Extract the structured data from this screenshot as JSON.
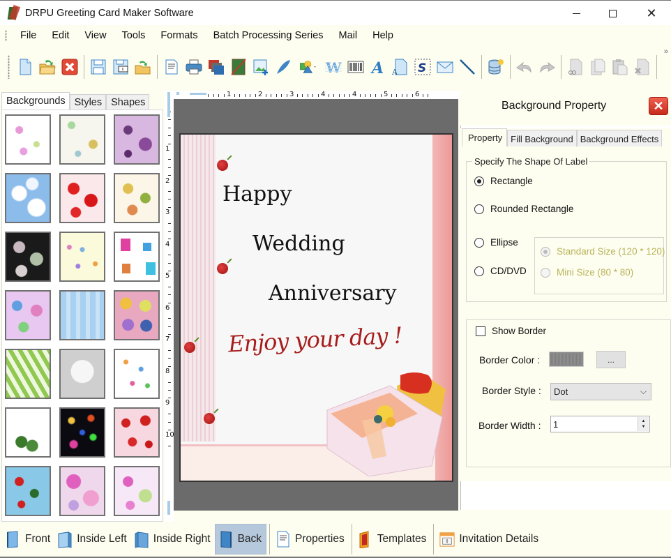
{
  "window": {
    "title": "DRPU Greeting Card Maker Software",
    "controls": [
      "minimize",
      "maximize",
      "close"
    ]
  },
  "menu": [
    "File",
    "Edit",
    "View",
    "Tools",
    "Formats",
    "Batch Processing Series",
    "Mail",
    "Help"
  ],
  "toolbar": {
    "groups": [
      [
        "new-icon",
        "open-icon",
        "close-file-icon"
      ],
      [
        "save-icon",
        "save-as-icon",
        "export-icon"
      ],
      [
        "print-preview-icon",
        "print-icon",
        "batch-print-icon",
        "crop-image-icon",
        "insert-picture-icon",
        "signature-pen-icon",
        "shapes-icon",
        "wordart-icon",
        "barcode-icon",
        "text-icon",
        "text-document-icon",
        "signature-icon",
        "email-icon",
        "line-icon"
      ],
      [
        "database-icon"
      ],
      [
        "undo-icon",
        "redo-icon"
      ],
      [
        "cut-icon",
        "copy-icon",
        "paste-icon",
        "delete-icon"
      ]
    ],
    "overflow_label": "»"
  },
  "left_panel": {
    "tabs": [
      {
        "label": "Backgrounds",
        "active": true
      },
      {
        "label": "Styles",
        "active": false
      },
      {
        "label": "Shapes",
        "active": false
      }
    ],
    "thumbnails": [
      "baby-doodles",
      "baby-sketch",
      "purple-flowers",
      "sky-clouds",
      "strawberries",
      "autumn-leaves",
      "dark-leaves",
      "hearts-rows",
      "gift-boxes",
      "colorful-flowers",
      "blue-snowflakes",
      "pink-circles",
      "green-trees",
      "white-heart",
      "kids-doodles",
      "green-ornament",
      "fireworks",
      "red-hearts",
      "santa-pattern",
      "pink-pompoms",
      "pink-butterflies"
    ]
  },
  "rulers": {
    "top_labels": [
      "1",
      "2",
      "3",
      "4",
      "4",
      "5",
      "6"
    ],
    "left_labels": [
      "1",
      "2",
      "3",
      "4",
      "5",
      "6",
      "7",
      "8",
      "9",
      "10"
    ]
  },
  "card": {
    "line1": "Happy",
    "line2": "Wedding",
    "line3": "Anniversary",
    "script": "Enjoy your day !"
  },
  "property_panel": {
    "title": "Background Property",
    "tabs": [
      {
        "label": "Property",
        "active": true
      },
      {
        "label": "Fill Background",
        "active": false
      },
      {
        "label": "Background Effects",
        "active": false
      }
    ],
    "shape_group": {
      "legend": "Specify The Shape Of Label",
      "options": [
        {
          "label": "Rectangle",
          "checked": true
        },
        {
          "label": "Rounded Rectangle",
          "checked": false
        },
        {
          "label": "Ellipse",
          "checked": false
        },
        {
          "label": "CD/DVD",
          "checked": false
        }
      ],
      "cd_sizes": [
        {
          "label": "Standard Size (120 * 120)",
          "checked": true,
          "enabled": false
        },
        {
          "label": "Mini Size (80 * 80)",
          "checked": false,
          "enabled": false
        }
      ]
    },
    "border": {
      "show_border_label": "Show Border",
      "show_border": false,
      "color_label": "Border Color :",
      "color_value": "#8a8a8a",
      "color_button": "...",
      "style_label": "Border Style :",
      "style_value": "Dot",
      "width_label": "Border Width :",
      "width_value": "1"
    }
  },
  "bottom_bar": [
    {
      "label": "Front",
      "icon": "front-page-icon",
      "active": false
    },
    {
      "label": "Inside Left",
      "icon": "inside-left-page-icon",
      "active": false
    },
    {
      "label": "Inside Right",
      "icon": "inside-right-page-icon",
      "active": false
    },
    {
      "label": "Back",
      "icon": "back-page-icon",
      "active": true
    },
    {
      "label": "Properties",
      "icon": "properties-icon",
      "active": false
    },
    {
      "label": "Templates",
      "icon": "templates-icon",
      "active": false
    },
    {
      "label": "Invitation Details",
      "icon": "invitation-details-icon",
      "active": false
    }
  ]
}
